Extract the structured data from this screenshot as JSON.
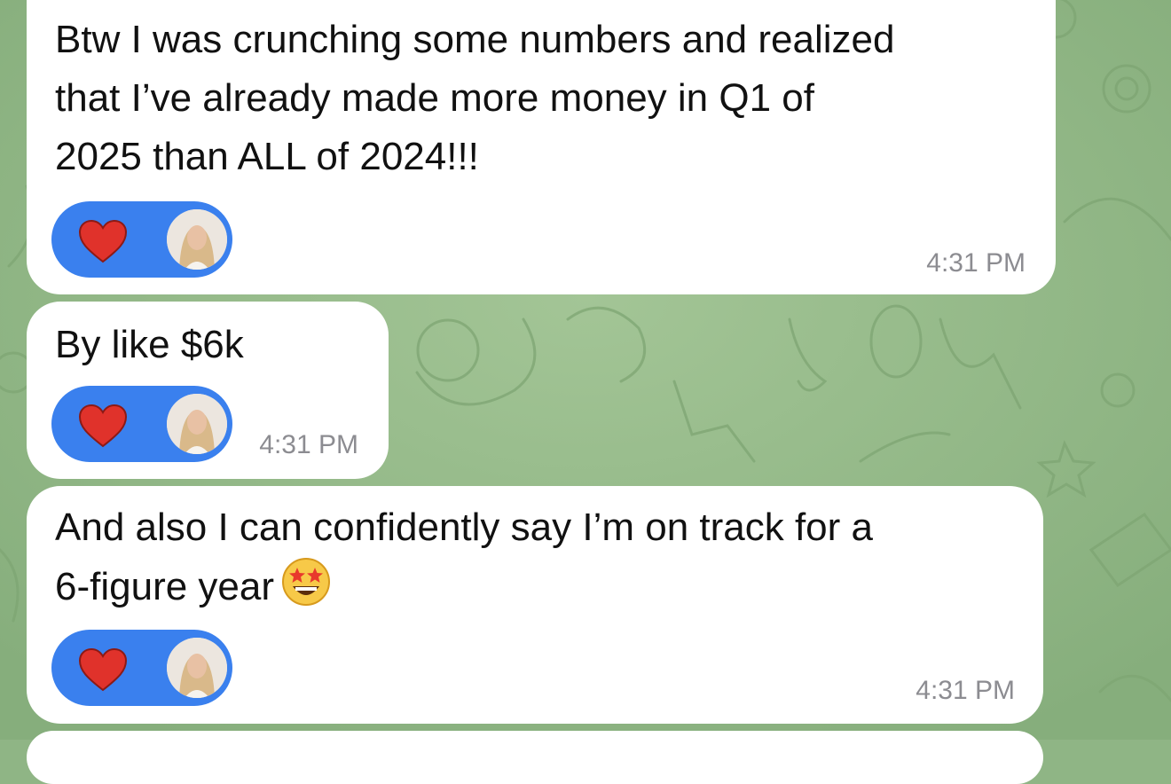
{
  "theme": {
    "accent": "#3a80ee",
    "bubble": "#ffffff",
    "wallpaper": "#8fb585",
    "heart": "#e0322b"
  },
  "messages": [
    {
      "text": "Btw I was crunching some numbers and realized\nthat I’ve already made more money in Q1 of\n2025 than ALL of 2024!!!",
      "time": "4:31 PM",
      "reaction": {
        "emoji_icon": "red-heart-icon",
        "reactor_icon": "avatar-icon"
      }
    },
    {
      "text": "By like $6k",
      "time": "4:31 PM",
      "reaction": {
        "emoji_icon": "red-heart-icon",
        "reactor_icon": "avatar-icon"
      }
    },
    {
      "text": "And also I can confidently say I’m on track for a\n6-figure year",
      "trailing_emoji": "star-struck-emoji-icon",
      "time": "4:31 PM",
      "reaction": {
        "emoji_icon": "red-heart-icon",
        "reactor_icon": "avatar-icon"
      }
    }
  ]
}
